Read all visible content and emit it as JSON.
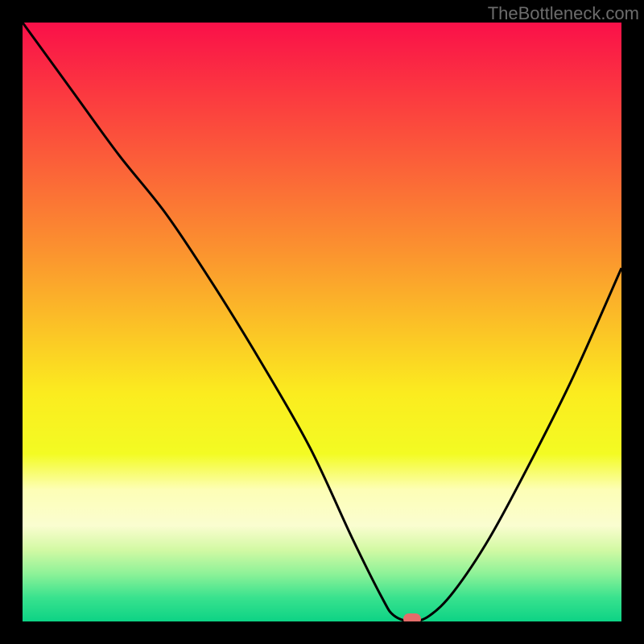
{
  "watermark": "TheBottleneck.com",
  "chart_data": {
    "type": "line",
    "title": "",
    "xlabel": "",
    "ylabel": "",
    "xlim": [
      0,
      100
    ],
    "ylim": [
      0,
      100
    ],
    "series": [
      {
        "name": "bottleneck-curve",
        "x": [
          0,
          8,
          16,
          24,
          32,
          40,
          48,
          55,
          60,
          62,
          65,
          68,
          72,
          78,
          85,
          92,
          100
        ],
        "y": [
          100,
          89,
          78,
          68,
          56,
          43,
          29,
          14,
          4,
          1,
          0,
          1,
          5,
          14,
          27,
          41,
          59
        ]
      }
    ],
    "marker": {
      "x": 65,
      "y": 0,
      "color": "#e46d6a"
    },
    "background_gradient": {
      "stops": [
        {
          "pct": 0,
          "color": "#fa1049"
        },
        {
          "pct": 12,
          "color": "#fb3940"
        },
        {
          "pct": 25,
          "color": "#fb6538"
        },
        {
          "pct": 38,
          "color": "#fb922f"
        },
        {
          "pct": 50,
          "color": "#fbbf27"
        },
        {
          "pct": 62,
          "color": "#fbec1f"
        },
        {
          "pct": 72,
          "color": "#f3fb23"
        },
        {
          "pct": 78,
          "color": "#fdfeb6"
        },
        {
          "pct": 84,
          "color": "#fafdd0"
        },
        {
          "pct": 88,
          "color": "#d3f9a4"
        },
        {
          "pct": 92,
          "color": "#8ef298"
        },
        {
          "pct": 96,
          "color": "#39e28e"
        },
        {
          "pct": 100,
          "color": "#0dd385"
        }
      ]
    }
  }
}
